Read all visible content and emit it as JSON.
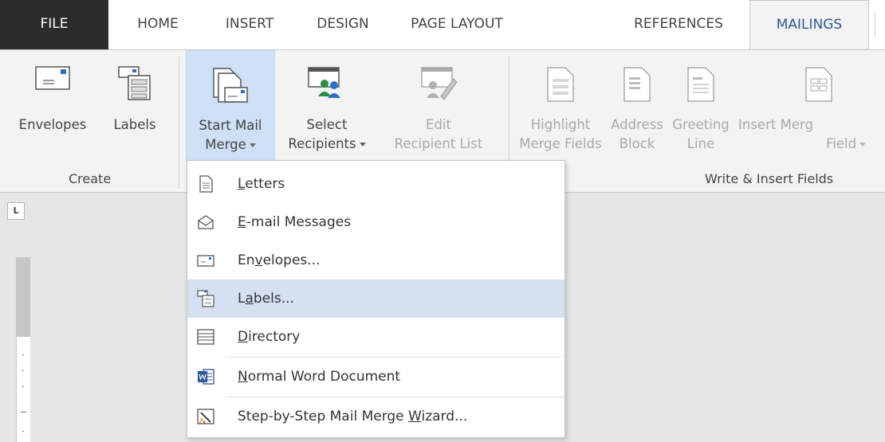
{
  "tabs": [
    {
      "label": "FILE"
    },
    {
      "label": "HOME"
    },
    {
      "label": "INSERT"
    },
    {
      "label": "DESIGN"
    },
    {
      "label": "PAGE LAYOUT"
    },
    {
      "label": "REFERENCES"
    },
    {
      "label": "MAILINGS",
      "active": true
    }
  ],
  "ribbon": {
    "envelopes": {
      "label": "Envelopes",
      "icon": "envelope-icon"
    },
    "labels": {
      "label": "Labels",
      "icon": "labels-icon"
    },
    "start_mail_merge": {
      "line1": "Start Mail",
      "line2": "Merge",
      "icon": "start-mail-merge-icon",
      "selected": true
    },
    "select_recipients": {
      "line1": "Select",
      "line2": "Recipients",
      "icon": "select-recipients-icon"
    },
    "edit_recipient_list": {
      "line1": "Edit",
      "line2": "Recipient List",
      "icon": "edit-recipient-list-icon",
      "disabled": true
    },
    "highlight_merge_fields": {
      "line1": "Highlight",
      "line2": "Merge Fields",
      "icon": "highlight-merge-fields-icon",
      "disabled": true
    },
    "address_block": {
      "line1": "Address",
      "line2": "Block",
      "icon": "address-block-icon",
      "disabled": true
    },
    "greeting_line": {
      "line1": "Greeting",
      "line2": "Line",
      "icon": "greeting-line-icon",
      "disabled": true
    },
    "insert_merge_field": {
      "line1": "Insert Merg",
      "line2": "Field",
      "icon": "insert-merge-field-icon",
      "disabled": true
    },
    "groups": {
      "create": "Create",
      "write_insert": "Write & Insert Fields"
    }
  },
  "document": {
    "ruler_corner": "L"
  },
  "menu": {
    "items": [
      {
        "before": "",
        "key": "L",
        "after": "etters",
        "icon": "letter-icon"
      },
      {
        "before": "",
        "key": "E",
        "after": "-mail Messages",
        "icon": "email-icon"
      },
      {
        "before": "En",
        "key": "v",
        "after": "elopes...",
        "icon": "envelope-icon"
      },
      {
        "before": "L",
        "key": "a",
        "after": "bels...",
        "icon": "labels-icon",
        "hover": true
      },
      {
        "before": "",
        "key": "D",
        "after": "irectory",
        "icon": "directory-icon"
      },
      {
        "before": "",
        "key": "N",
        "after": "ormal Word Document",
        "icon": "word-document-icon"
      },
      {
        "before": "Step-by-Step Mail Merge ",
        "key": "W",
        "after": "izard...",
        "icon": "wizard-icon"
      }
    ]
  },
  "colors": {
    "accent": "#2b579a",
    "file_tab": "#2b2b2b",
    "ribbon_bg": "#f3f3f3",
    "selected": "#cde0f5",
    "menu_hover": "#d5e1f2",
    "disabled_text": "#a8a8a8",
    "workspace": "#e6e6e6"
  }
}
